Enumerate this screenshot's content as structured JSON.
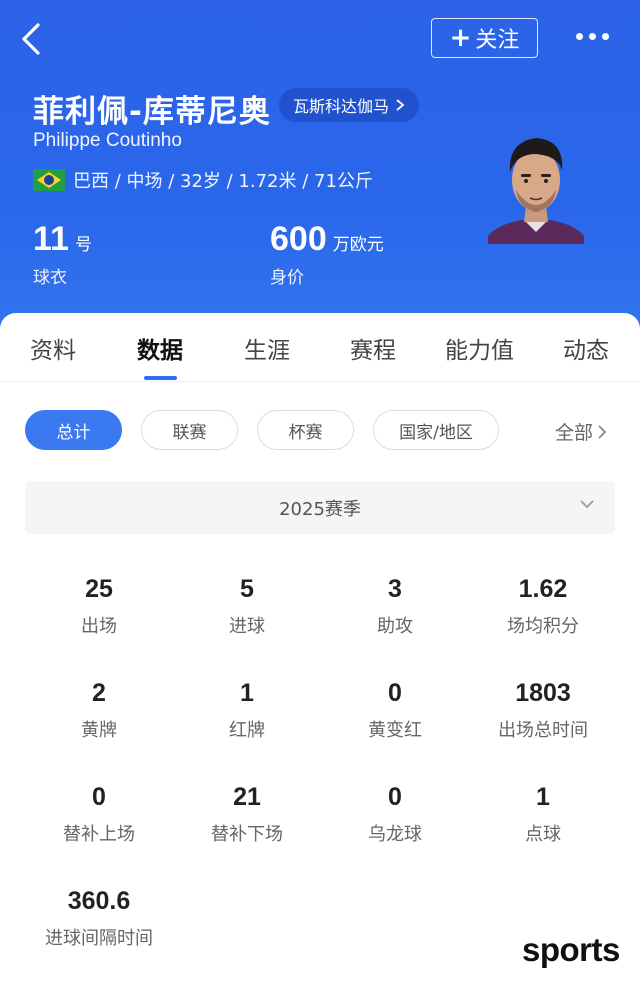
{
  "header": {
    "follow_label": "关注",
    "player_name": "菲利佩-库蒂尼奥",
    "club": "瓦斯科达伽马",
    "english_name": "Philippe Coutinho",
    "info": "巴西 / 中场 / 32岁 / 1.72米 / 71公斤",
    "jersey_number": "11",
    "jersey_unit": "号",
    "jersey_caption": "球衣",
    "market_value": "600",
    "market_value_unit": "万欧元",
    "market_value_caption": "身价"
  },
  "tabs": [
    "资料",
    "数据",
    "生涯",
    "赛程",
    "能力值",
    "动态"
  ],
  "active_tab": "数据",
  "filters": {
    "chips": [
      "总计",
      "联赛",
      "杯赛",
      "国家/地区"
    ],
    "all_label": "全部"
  },
  "season_label": "2025赛季",
  "stats": [
    {
      "value": "25",
      "label": "出场"
    },
    {
      "value": "5",
      "label": "进球"
    },
    {
      "value": "3",
      "label": "助攻"
    },
    {
      "value": "1.62",
      "label": "场均积分"
    },
    {
      "value": "2",
      "label": "黄牌"
    },
    {
      "value": "1",
      "label": "红牌"
    },
    {
      "value": "0",
      "label": "黄变红"
    },
    {
      "value": "1803",
      "label": "出场总时间"
    },
    {
      "value": "0",
      "label": "替补上场"
    },
    {
      "value": "21",
      "label": "替补下场"
    },
    {
      "value": "0",
      "label": "乌龙球"
    },
    {
      "value": "1",
      "label": "点球"
    },
    {
      "value": "360.6",
      "label": "进球间隔时间"
    }
  ],
  "watermark": "sports",
  "colors": {
    "header_blue": "#2c63e8",
    "accent_blue": "#3a79f0",
    "brazil_green": "#229e45",
    "brazil_yellow": "#f8d52a"
  }
}
